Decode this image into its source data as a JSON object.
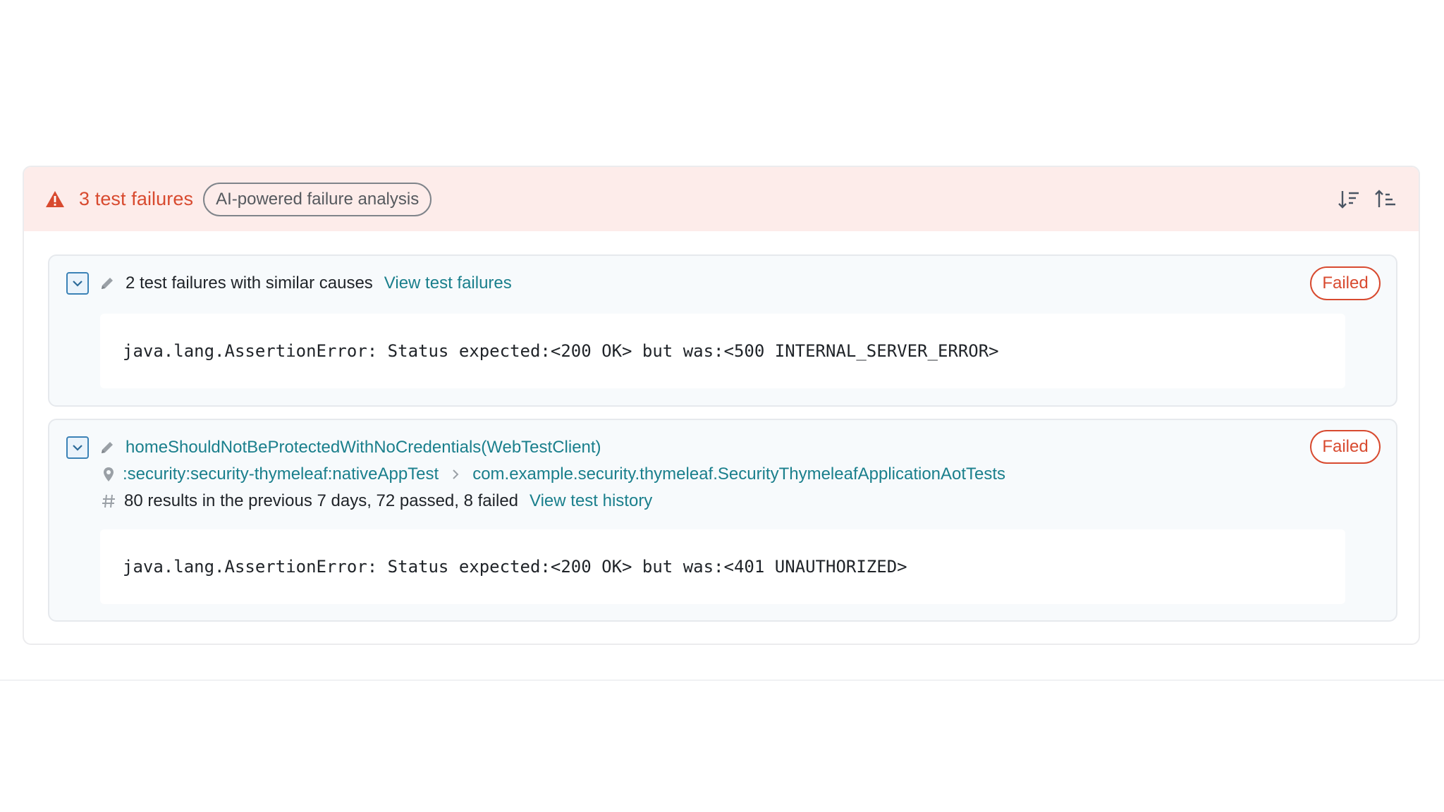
{
  "header": {
    "failure_count_label": "3 test failures",
    "ai_badge_label": "AI-powered failure analysis"
  },
  "cards": [
    {
      "title": "2 test failures with similar causes",
      "link_label": "View test failures",
      "status": "Failed",
      "error": "java.lang.AssertionError: Status expected:<200 OK> but was:<500 INTERNAL_SERVER_ERROR>"
    },
    {
      "title": "homeShouldNotBeProtectedWithNoCredentials(WebTestClient)",
      "location_project": ":security:security-thymeleaf:nativeAppTest",
      "location_class": "com.example.security.thymeleaf.SecurityThymeleafApplicationAotTests",
      "results_summary": "80 results in the previous 7 days, 72 passed, 8 failed",
      "history_link_label": "View test history",
      "status": "Failed",
      "error": "java.lang.AssertionError: Status expected:<200 OK> but was:<401 UNAUTHORIZED>"
    }
  ],
  "colors": {
    "danger": "#d84a2f",
    "link": "#1a7f8c",
    "header_bg": "#fdecea",
    "toggle_border": "#3b82b6"
  },
  "icons": [
    "warning-icon",
    "sort-descending-icon",
    "sort-ascending-icon",
    "chevron-down-icon",
    "pencil-icon",
    "location-pin-icon",
    "chevron-right-icon",
    "hash-icon"
  ]
}
